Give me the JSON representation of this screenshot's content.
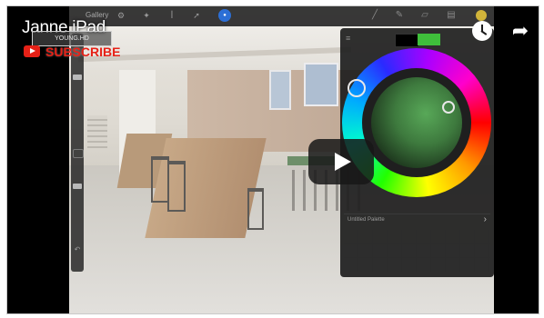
{
  "video": {
    "channel_title": "Janne iPad",
    "watermark_text": "YOUNG.HD",
    "subscribe_label": "SUBSCRIBE",
    "clock_icon": "clock-icon",
    "share_icon": "share-arrow-icon",
    "play_icon": "play-icon"
  },
  "app": {
    "gallery_label": "Gallery",
    "toolbar_icons": [
      "wrench-icon",
      "magic-wand-icon",
      "selection-icon",
      "transform-icon"
    ],
    "right_tools": [
      "brush-icon",
      "smudge-icon",
      "eraser-icon",
      "layers-icon"
    ],
    "active_color": "#d1b43a"
  },
  "color_panel": {
    "menu_icon": "menu-icon",
    "primary_swatch": "#000000",
    "secondary_swatch": "#3fbf3b",
    "palette_label": "Untitled Palette",
    "palette_arrow": "›"
  },
  "sidebar": {
    "undo_icon": "undo-icon"
  }
}
